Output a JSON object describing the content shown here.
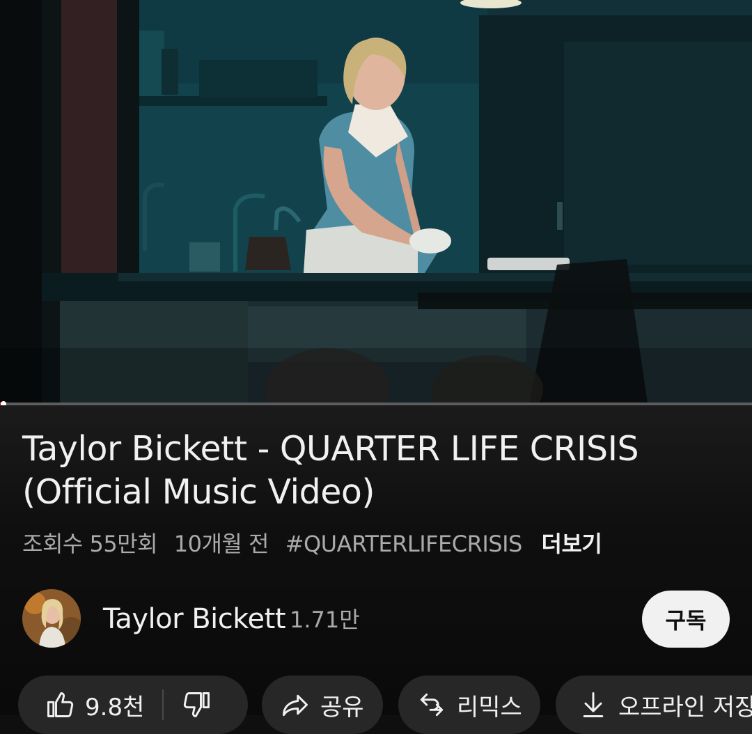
{
  "video": {
    "progress_fraction": 0.005
  },
  "title": {
    "line1": "Taylor Bickett - QUARTER LIFE CRISIS",
    "line2": "(Official Music Video)"
  },
  "meta": {
    "views": "조회수 55만회",
    "age": "10개월 전",
    "hashtag": "#QUARTERLIFECRISIS",
    "more": "더보기"
  },
  "channel": {
    "name": "Taylor Bickett",
    "subscribers": "1.71만",
    "subscribe_label": "구독"
  },
  "actions": {
    "likes": "9.8천",
    "share": "공유",
    "remix": "리믹스",
    "offline": "오프라인 저장"
  },
  "icons": {
    "like": "thumbs-up-icon",
    "dislike": "thumbs-down-icon",
    "share": "share-arrow-icon",
    "remix": "remix-icon",
    "offline": "download-icon"
  },
  "colors": {
    "background": "#0f0f0f",
    "chip": "#272727",
    "subscribe_bg": "#f1f1f1",
    "progress": "#ff0000"
  }
}
